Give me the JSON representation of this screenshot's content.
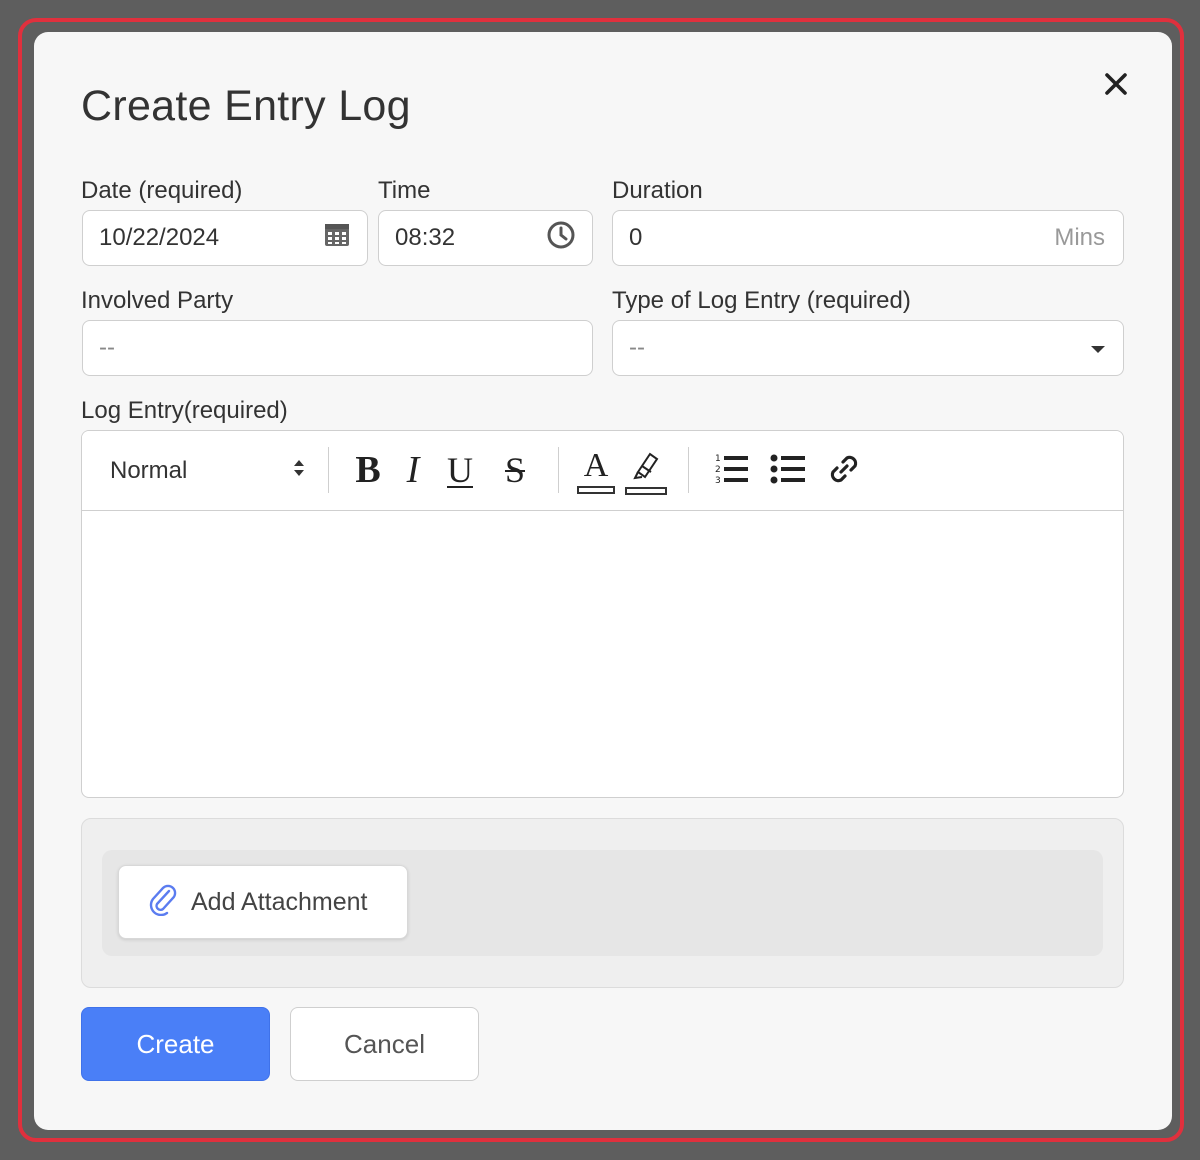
{
  "dialog": {
    "title": "Create Entry Log",
    "close_icon": "close-icon"
  },
  "fields": {
    "date": {
      "label": "Date (required)",
      "value": "10/22/2024",
      "icon": "calendar-icon"
    },
    "time": {
      "label": "Time",
      "value": "08:32",
      "icon": "clock-icon"
    },
    "duration": {
      "label": "Duration",
      "value": "0",
      "unit": "Mins"
    },
    "involved_party": {
      "label": "Involved Party",
      "placeholder": "--"
    },
    "log_type": {
      "label": "Type of Log Entry (required)",
      "selected": "--",
      "icon": "caret-down-icon"
    },
    "log_entry": {
      "label": "Log Entry(required)",
      "value": ""
    }
  },
  "toolbar": {
    "format_selected": "Normal",
    "bold_glyph": "B",
    "italic_glyph": "I",
    "underline_glyph": "U",
    "strike_glyph": "S",
    "color_glyph": "A",
    "icons": [
      "bold-icon",
      "italic-icon",
      "underline-icon",
      "strikethrough-icon",
      "text-color-icon",
      "highlight-icon",
      "ordered-list-icon",
      "bullet-list-icon",
      "link-icon"
    ]
  },
  "attachments": {
    "button_label": "Add Attachment",
    "icon": "paperclip-icon"
  },
  "actions": {
    "create_label": "Create",
    "cancel_label": "Cancel"
  },
  "colors": {
    "primary": "#4a7ff7",
    "highlight_frame": "#e0303d",
    "paperclip": "#5b7cf0"
  }
}
